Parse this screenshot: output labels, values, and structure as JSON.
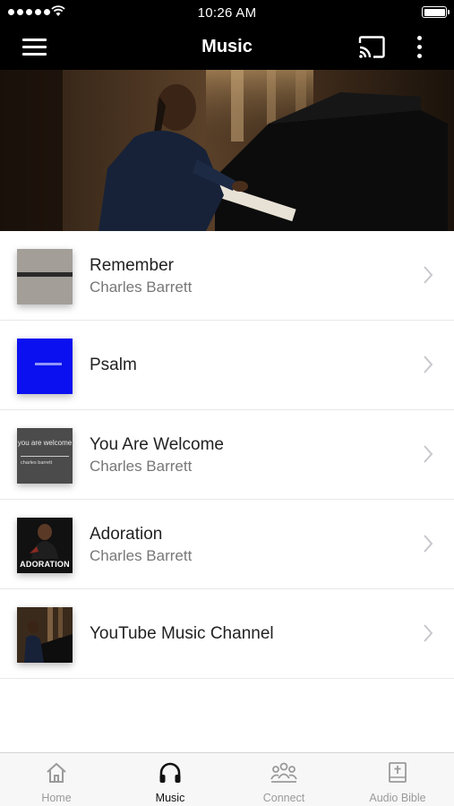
{
  "status_bar": {
    "time": "10:26 AM"
  },
  "header": {
    "title": "Music"
  },
  "music_list": [
    {
      "title": "Remember",
      "subtitle": "Charles Barrett",
      "thumb_icon": "album-art-remember"
    },
    {
      "title": "Psalm",
      "subtitle": "",
      "thumb_icon": "album-art-psalm"
    },
    {
      "title": "You Are Welcome",
      "subtitle": "Charles Barrett",
      "thumb_icon": "album-art-you-are-welcome",
      "thumb_text": "you are welcome",
      "thumb_subtext": "charles barrett"
    },
    {
      "title": "Adoration",
      "subtitle": "Charles Barrett",
      "thumb_icon": "album-art-adoration",
      "thumb_text": "ADORATION"
    },
    {
      "title": "YouTube Music Channel",
      "subtitle": "",
      "thumb_icon": "youtube-channel-thumbnail"
    }
  ],
  "tab_bar": {
    "tabs": [
      {
        "label": "Home",
        "icon": "home-icon",
        "active": false
      },
      {
        "label": "Music",
        "icon": "headphones-icon",
        "active": true
      },
      {
        "label": "Connect",
        "icon": "people-icon",
        "active": false
      },
      {
        "label": "Audio Bible",
        "icon": "bible-icon",
        "active": false
      }
    ]
  },
  "colors": {
    "nav_background": "#000000",
    "accent_active": "#111111",
    "inactive": "#9a9a9a",
    "psalm_blue": "#0a10ef"
  }
}
